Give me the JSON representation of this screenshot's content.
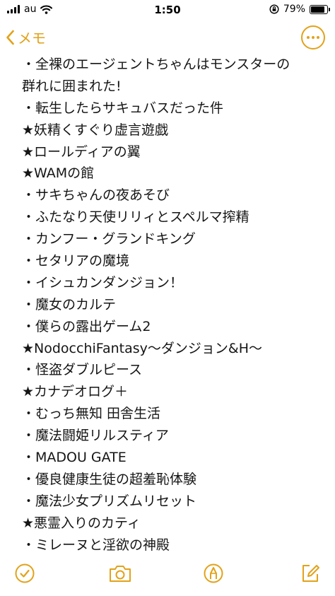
{
  "status_bar": {
    "carrier": "au",
    "time": "1:50",
    "battery_percent": "79%",
    "battery_level": 0.79
  },
  "nav": {
    "back_label": "メモ",
    "accent_color": "#e2a21a"
  },
  "note": {
    "lines": [
      "・全裸のエージェントちゃんはモンスターの",
      "群れに囲まれた!",
      "・転生したらサキュバスだった件",
      "★妖精くすぐり虚言遊戯",
      "★ロールディアの翼",
      "★WAMの館",
      "・サキちゃんの夜あそび",
      "・ふたなり天使リリィとスペルマ搾精",
      "・カンフー・グランドキング",
      "・セタリアの魔境",
      "・イシュカンダンジョン！",
      "・魔女のカルテ",
      "・僕らの露出ゲーム2",
      "★NodocchiFantasy〜ダンジョン&H〜",
      "・怪盗ダブルピース",
      "★カナデオログ＋",
      "・むっち無知 田舎生活",
      "・魔法闘姫リルスティア",
      "・MADOU GATE",
      "・優良健康生徒の超羞恥体験",
      "・魔法少女プリズムリセット",
      "★悪霊入りのカティ",
      "・ミレーヌと淫欲の神殿"
    ]
  },
  "toolbar": {
    "icons": [
      "checklist-icon",
      "camera-icon",
      "markup-icon",
      "compose-icon"
    ]
  }
}
